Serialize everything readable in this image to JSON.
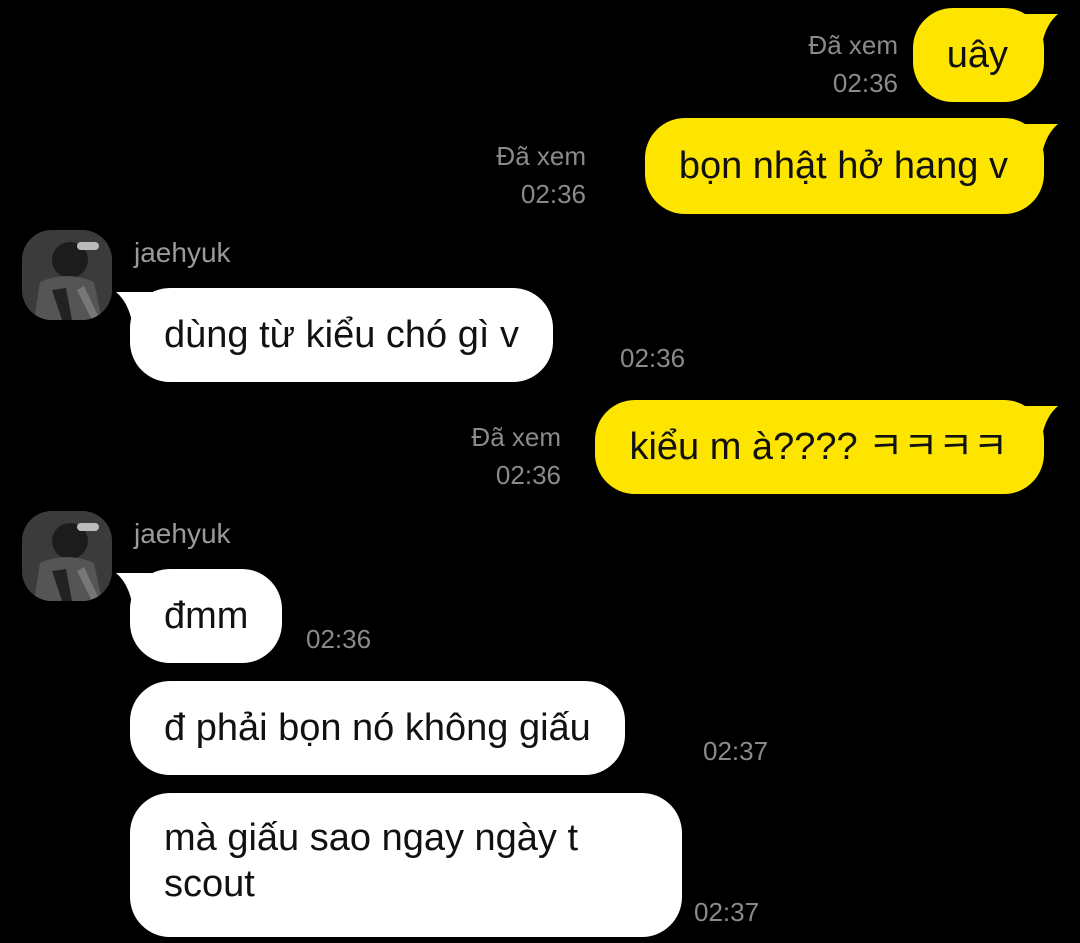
{
  "messages": {
    "m1": {
      "text": "uây",
      "seen": "Đã xem",
      "time": "02:36"
    },
    "m2": {
      "text": "bọn nhật hở hang v",
      "seen": "Đã xem",
      "time": "02:36"
    },
    "g1": {
      "sender": "jaehyuk",
      "msg1": {
        "text": "dùng từ kiểu chó gì v",
        "time": "02:36"
      }
    },
    "m3": {
      "text": "kiểu m à???? ㅋㅋㅋㅋ",
      "seen": "Đã xem",
      "time": "02:36"
    },
    "g2": {
      "sender": "jaehyuk",
      "msg1": {
        "text": "đmm",
        "time": "02:36"
      },
      "msg2": {
        "text": "đ phải bọn nó không giấu",
        "time": "02:37"
      },
      "msg3": {
        "line1": "mà giấu sao ngay ngày t",
        "line2": "scout",
        "time": "02:37"
      }
    }
  },
  "colors": {
    "background": "#000000",
    "mine_bubble": "#FEE500",
    "their_bubble": "#FFFFFF",
    "meta_text": "#8A8A8A"
  },
  "icons": {
    "avatar": "profile-photo-avatar"
  }
}
